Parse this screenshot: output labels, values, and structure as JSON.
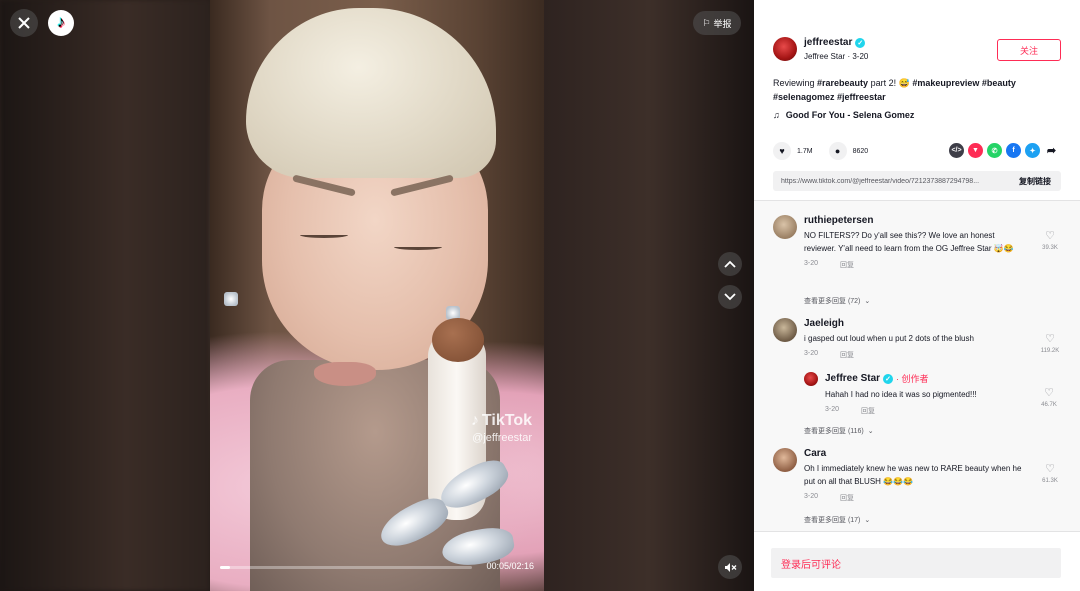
{
  "player": {
    "report_label": "举报",
    "watermark_brand": "TikTok",
    "watermark_handle": "@jeffreestar",
    "time_display": "00:05/02:16",
    "progress": 0.04
  },
  "post": {
    "author_handle": "jeffreestar",
    "author_display": "Jeffree Star",
    "date": "3-20",
    "follow_label": "关注",
    "desc_text": "Reviewing ",
    "hashtags": [
      "#rarebeauty",
      "part 2! 😅",
      "#makeupreview",
      "#beauty",
      "#selenagomez",
      "#jeffreestar"
    ],
    "music": "Good For You - Selena Gomez",
    "likes": "1.7M",
    "comments_count": "8620",
    "link_url": "https://www.tiktok.com/@jeffreestar/video/7212373887294798...",
    "copy_label": "复制链接"
  },
  "comments": [
    {
      "user": "ruthiepetersen",
      "text": "NO FILTERS?? Do y'all see this?? We love an honest reviewer. Y'all need to learn from the OG Jeffree Star 🤯😂",
      "date": "3-20",
      "reply_label": "回复",
      "likes": "39.3K",
      "more": "查看更多回复 (72)"
    },
    {
      "user": "Jaeleigh",
      "text": "i gasped out loud when u put 2 dots of the blush",
      "date": "3-20",
      "reply_label": "回复",
      "likes": "119.2K",
      "reply": {
        "user": "Jeffree Star",
        "creator_tag": "· 创作者",
        "text": "Hahah I had no idea it was so pigmented!!!",
        "date": "3-20",
        "reply_label": "回复",
        "likes": "46.7K"
      },
      "more": "查看更多回复 (116)"
    },
    {
      "user": "Cara",
      "text": "Oh I immediately knew he was new to RARE beauty when he put on all that BLUSH 😂😂😂",
      "date": "3-20",
      "reply_label": "回复",
      "likes": "61.3K",
      "more": "查看更多回复 (17)"
    }
  ],
  "comment_input_placeholder": "登录后可评论",
  "colors": {
    "accent": "#fe2c55",
    "verified": "#20d5ec"
  }
}
